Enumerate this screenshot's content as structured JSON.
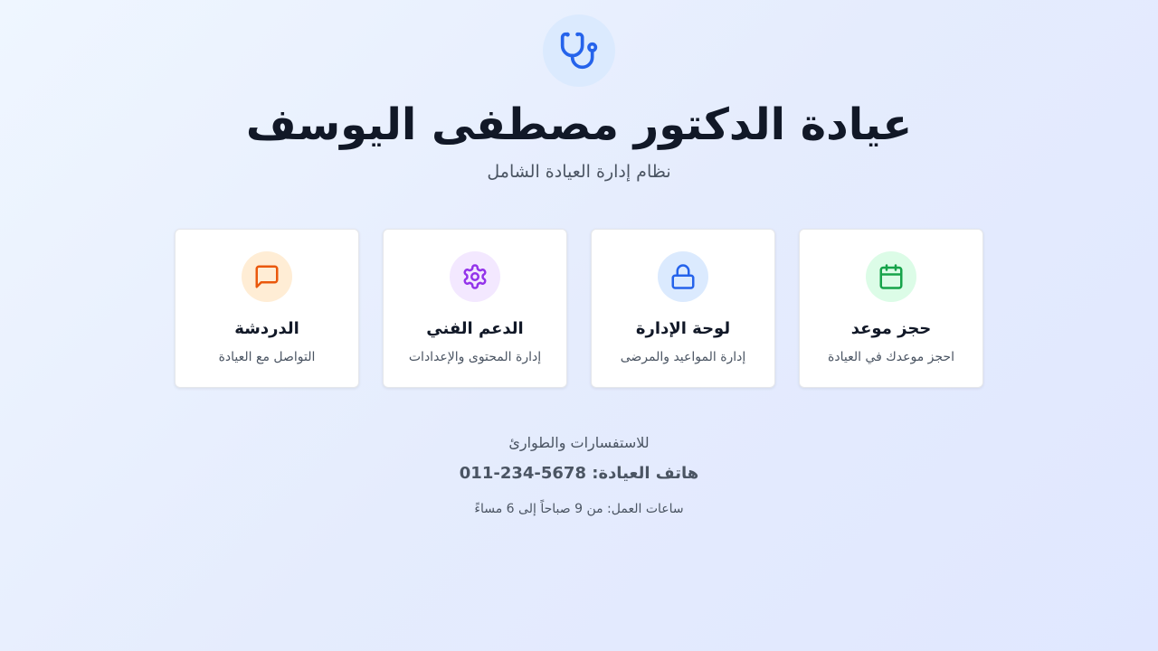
{
  "header": {
    "icon": "stethoscope-icon",
    "title": "عيادة الدكتور مصطفى اليوسف",
    "subtitle": "نظام إدارة العيادة الشامل"
  },
  "cards": [
    {
      "title": "حجز موعد",
      "description": "احجز موعدك في العيادة",
      "icon": "calendar-icon",
      "icon_color": "#16a34a",
      "icon_bg": "#dcfce7"
    },
    {
      "title": "لوحة الإدارة",
      "description": "إدارة المواعيد والمرضى",
      "icon": "lock-icon",
      "icon_color": "#2563eb",
      "icon_bg": "#dbeafe"
    },
    {
      "title": "الدعم الفني",
      "description": "إدارة المحتوى والإعدادات",
      "icon": "gear-icon",
      "icon_color": "#9333ea",
      "icon_bg": "#f3e8ff"
    },
    {
      "title": "الدردشة",
      "description": "التواصل مع العيادة",
      "icon": "chat-icon",
      "icon_color": "#ea580c",
      "icon_bg": "#ffedd5"
    }
  ],
  "footer": {
    "inquiries_label": "للاستفسارات والطوارئ",
    "phone_label": "هاتف العيادة:",
    "phone_number": "011-234-5678",
    "hours": "ساعات العمل: من 9 صباحاً إلى 6 مساءً"
  },
  "colors": {
    "accent": "#2563eb",
    "title": "#111827",
    "muted": "#4b5563"
  }
}
